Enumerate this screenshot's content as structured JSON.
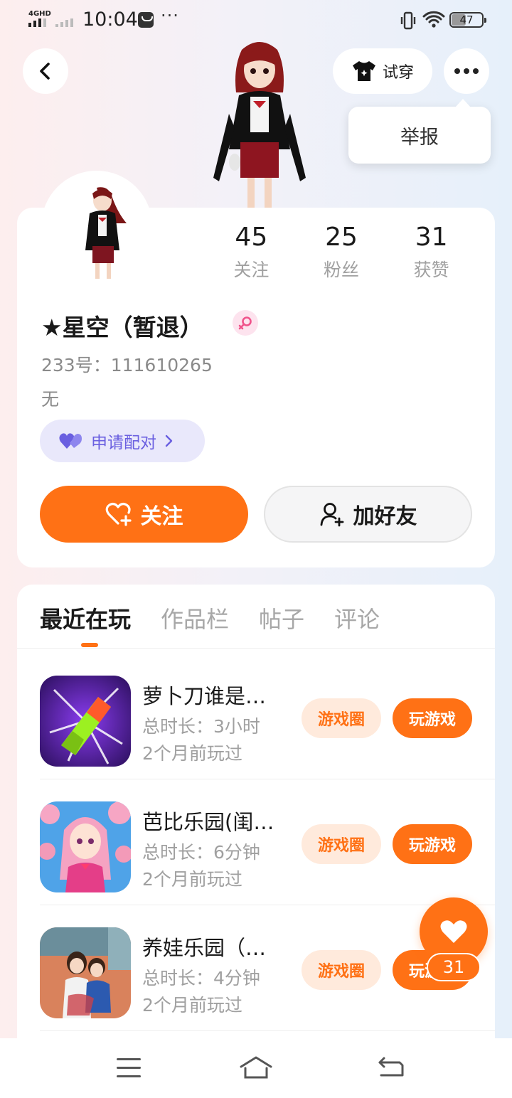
{
  "status_bar": {
    "network": "4GHD",
    "time": "10:04",
    "more": "···",
    "battery": "47"
  },
  "header": {
    "tryon_label": "试穿",
    "report_label": "举报"
  },
  "profile": {
    "stats": [
      {
        "value": "45",
        "label": "关注"
      },
      {
        "value": "25",
        "label": "粉丝"
      },
      {
        "value": "31",
        "label": "获赞"
      }
    ],
    "username": "★星空（暂退）",
    "uid": "233号：111610265",
    "bio": "无",
    "pair_label": "申请配对",
    "follow_label": "关注",
    "add_friend_label": "加好友"
  },
  "tabs": [
    {
      "label": "最近在玩",
      "active": true
    },
    {
      "label": "作品栏",
      "active": false
    },
    {
      "label": "帖子",
      "active": false
    },
    {
      "label": "评论",
      "active": false
    }
  ],
  "games": [
    {
      "name": "萝卜刀谁是…",
      "duration": "总时长：3小时",
      "last_played": "2个月前玩过",
      "circle_label": "游戏圈",
      "play_label": "玩游戏",
      "icon": "knife-game-icon"
    },
    {
      "name": "芭比乐园(闺…",
      "duration": "总时长：6分钟",
      "last_played": "2个月前玩过",
      "circle_label": "游戏圈",
      "play_label": "玩游戏",
      "icon": "anime-girl-game-icon"
    },
    {
      "name": "养娃乐园（…",
      "duration": "总时长：4分钟",
      "last_played": "2个月前玩过",
      "circle_label": "游戏圈",
      "play_label": "玩游戏",
      "icon": "family-game-icon"
    }
  ],
  "floating_like": {
    "count": "31"
  },
  "colors": {
    "accent": "#ff7115",
    "accent_light": "#ffeadc",
    "pair_bg": "#e9e8fb",
    "pair_text": "#6a5fe0"
  }
}
